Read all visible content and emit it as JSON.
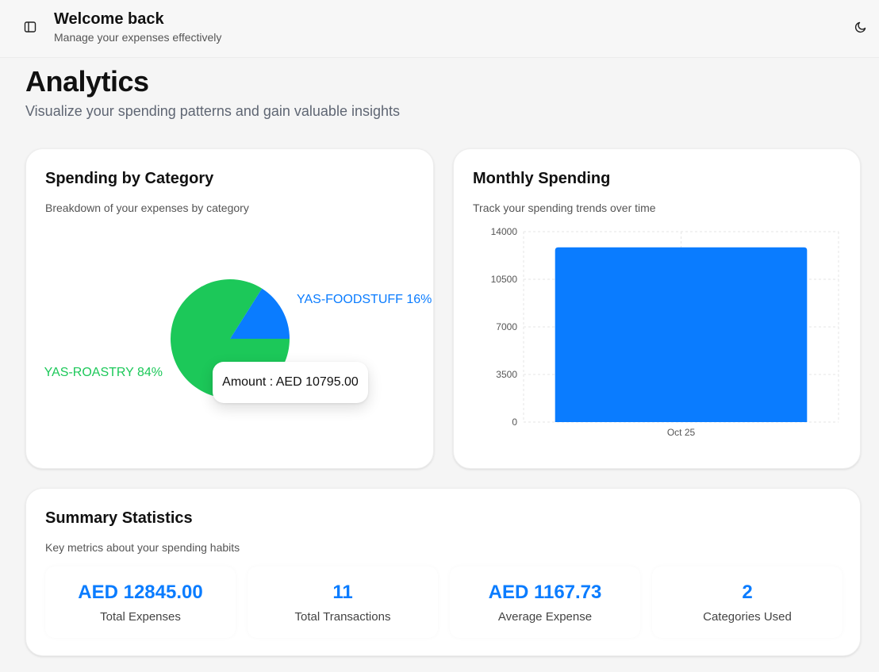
{
  "header": {
    "title": "Welcome back",
    "subtitle": "Manage your expenses effectively",
    "sidebar_toggle_icon": "sidebar-panel-icon",
    "theme_toggle_icon": "moon-icon"
  },
  "page": {
    "title": "Analytics",
    "subtitle": "Visualize your spending patterns and gain valuable insights"
  },
  "colors": {
    "accent": "#0a7cff",
    "green": "#1cc859",
    "blue": "#0a7cff"
  },
  "category_card": {
    "title": "Spending by Category",
    "description": "Breakdown of your expenses by category",
    "tooltip": "Amount : AED 10795.00"
  },
  "monthly_card": {
    "title": "Monthly Spending",
    "description": "Track your spending trends over time"
  },
  "summary_card": {
    "title": "Summary Statistics",
    "description": "Key metrics about your spending habits",
    "stats": [
      {
        "value": "AED 12845.00",
        "label": "Total Expenses"
      },
      {
        "value": "11",
        "label": "Total Transactions"
      },
      {
        "value": "AED 1167.73",
        "label": "Average Expense"
      },
      {
        "value": "2",
        "label": "Categories Used"
      }
    ]
  },
  "chart_data": [
    {
      "type": "pie",
      "slices": [
        {
          "label": "YAS-ROASTRY 84%",
          "value": 84,
          "color": "#1cc859"
        },
        {
          "label": "YAS-FOODSTUFF 16%",
          "value": 16,
          "color": "#0a7cff"
        }
      ]
    },
    {
      "type": "bar",
      "categories": [
        "Oct 25"
      ],
      "values": [
        12845
      ],
      "yticks": [
        "0",
        "3500",
        "7000",
        "10500",
        "14000"
      ],
      "ylim": [
        0,
        14000
      ],
      "color": "#0a7cff",
      "grid": true
    }
  ]
}
